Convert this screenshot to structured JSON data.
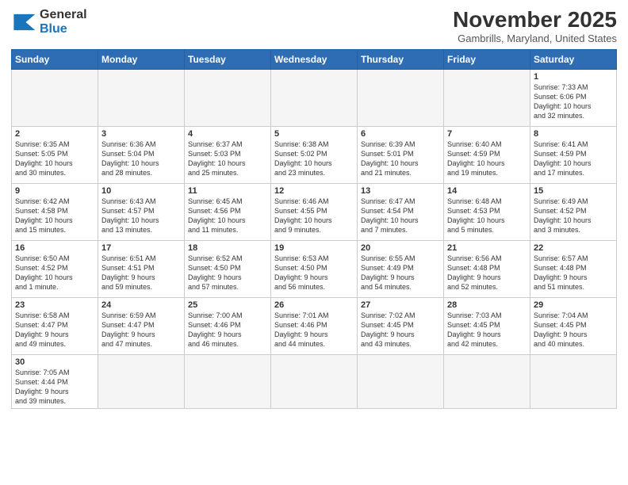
{
  "logo": {
    "line1": "General",
    "line2": "Blue"
  },
  "title": "November 2025",
  "subtitle": "Gambrills, Maryland, United States",
  "weekdays": [
    "Sunday",
    "Monday",
    "Tuesday",
    "Wednesday",
    "Thursday",
    "Friday",
    "Saturday"
  ],
  "weeks": [
    [
      {
        "day": "",
        "info": "",
        "empty": true
      },
      {
        "day": "",
        "info": "",
        "empty": true
      },
      {
        "day": "",
        "info": "",
        "empty": true
      },
      {
        "day": "",
        "info": "",
        "empty": true
      },
      {
        "day": "",
        "info": "",
        "empty": true
      },
      {
        "day": "",
        "info": "",
        "empty": true
      },
      {
        "day": "1",
        "info": "Sunrise: 7:33 AM\nSunset: 6:06 PM\nDaylight: 10 hours\nand 32 minutes."
      }
    ],
    [
      {
        "day": "2",
        "info": "Sunrise: 6:35 AM\nSunset: 5:05 PM\nDaylight: 10 hours\nand 30 minutes."
      },
      {
        "day": "3",
        "info": "Sunrise: 6:36 AM\nSunset: 5:04 PM\nDaylight: 10 hours\nand 28 minutes."
      },
      {
        "day": "4",
        "info": "Sunrise: 6:37 AM\nSunset: 5:03 PM\nDaylight: 10 hours\nand 25 minutes."
      },
      {
        "day": "5",
        "info": "Sunrise: 6:38 AM\nSunset: 5:02 PM\nDaylight: 10 hours\nand 23 minutes."
      },
      {
        "day": "6",
        "info": "Sunrise: 6:39 AM\nSunset: 5:01 PM\nDaylight: 10 hours\nand 21 minutes."
      },
      {
        "day": "7",
        "info": "Sunrise: 6:40 AM\nSunset: 4:59 PM\nDaylight: 10 hours\nand 19 minutes."
      },
      {
        "day": "8",
        "info": "Sunrise: 6:41 AM\nSunset: 4:59 PM\nDaylight: 10 hours\nand 17 minutes."
      }
    ],
    [
      {
        "day": "9",
        "info": "Sunrise: 6:42 AM\nSunset: 4:58 PM\nDaylight: 10 hours\nand 15 minutes."
      },
      {
        "day": "10",
        "info": "Sunrise: 6:43 AM\nSunset: 4:57 PM\nDaylight: 10 hours\nand 13 minutes."
      },
      {
        "day": "11",
        "info": "Sunrise: 6:45 AM\nSunset: 4:56 PM\nDaylight: 10 hours\nand 11 minutes."
      },
      {
        "day": "12",
        "info": "Sunrise: 6:46 AM\nSunset: 4:55 PM\nDaylight: 10 hours\nand 9 minutes."
      },
      {
        "day": "13",
        "info": "Sunrise: 6:47 AM\nSunset: 4:54 PM\nDaylight: 10 hours\nand 7 minutes."
      },
      {
        "day": "14",
        "info": "Sunrise: 6:48 AM\nSunset: 4:53 PM\nDaylight: 10 hours\nand 5 minutes."
      },
      {
        "day": "15",
        "info": "Sunrise: 6:49 AM\nSunset: 4:52 PM\nDaylight: 10 hours\nand 3 minutes."
      }
    ],
    [
      {
        "day": "16",
        "info": "Sunrise: 6:50 AM\nSunset: 4:52 PM\nDaylight: 10 hours\nand 1 minute."
      },
      {
        "day": "17",
        "info": "Sunrise: 6:51 AM\nSunset: 4:51 PM\nDaylight: 9 hours\nand 59 minutes."
      },
      {
        "day": "18",
        "info": "Sunrise: 6:52 AM\nSunset: 4:50 PM\nDaylight: 9 hours\nand 57 minutes."
      },
      {
        "day": "19",
        "info": "Sunrise: 6:53 AM\nSunset: 4:50 PM\nDaylight: 9 hours\nand 56 minutes."
      },
      {
        "day": "20",
        "info": "Sunrise: 6:55 AM\nSunset: 4:49 PM\nDaylight: 9 hours\nand 54 minutes."
      },
      {
        "day": "21",
        "info": "Sunrise: 6:56 AM\nSunset: 4:48 PM\nDaylight: 9 hours\nand 52 minutes."
      },
      {
        "day": "22",
        "info": "Sunrise: 6:57 AM\nSunset: 4:48 PM\nDaylight: 9 hours\nand 51 minutes."
      }
    ],
    [
      {
        "day": "23",
        "info": "Sunrise: 6:58 AM\nSunset: 4:47 PM\nDaylight: 9 hours\nand 49 minutes."
      },
      {
        "day": "24",
        "info": "Sunrise: 6:59 AM\nSunset: 4:47 PM\nDaylight: 9 hours\nand 47 minutes."
      },
      {
        "day": "25",
        "info": "Sunrise: 7:00 AM\nSunset: 4:46 PM\nDaylight: 9 hours\nand 46 minutes."
      },
      {
        "day": "26",
        "info": "Sunrise: 7:01 AM\nSunset: 4:46 PM\nDaylight: 9 hours\nand 44 minutes."
      },
      {
        "day": "27",
        "info": "Sunrise: 7:02 AM\nSunset: 4:45 PM\nDaylight: 9 hours\nand 43 minutes."
      },
      {
        "day": "28",
        "info": "Sunrise: 7:03 AM\nSunset: 4:45 PM\nDaylight: 9 hours\nand 42 minutes."
      },
      {
        "day": "29",
        "info": "Sunrise: 7:04 AM\nSunset: 4:45 PM\nDaylight: 9 hours\nand 40 minutes."
      }
    ],
    [
      {
        "day": "30",
        "info": "Sunrise: 7:05 AM\nSunset: 4:44 PM\nDaylight: 9 hours\nand 39 minutes."
      },
      {
        "day": "",
        "info": "",
        "empty": true
      },
      {
        "day": "",
        "info": "",
        "empty": true
      },
      {
        "day": "",
        "info": "",
        "empty": true
      },
      {
        "day": "",
        "info": "",
        "empty": true
      },
      {
        "day": "",
        "info": "",
        "empty": true
      },
      {
        "day": "",
        "info": "",
        "empty": true
      }
    ]
  ]
}
